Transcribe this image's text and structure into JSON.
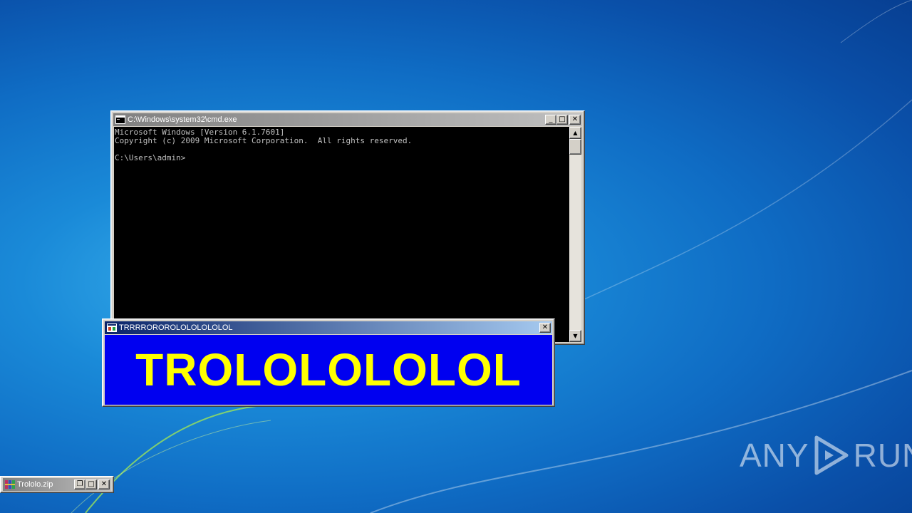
{
  "desktop": {
    "watermark_left": "ANY",
    "watermark_right": "RUN"
  },
  "cmd_window": {
    "title": "C:\\Windows\\system32\\cmd.exe",
    "console_lines": [
      "Microsoft Windows [Version 6.1.7601]",
      "Copyright (c) 2009 Microsoft Corporation.  All rights reserved.",
      "",
      "C:\\Users\\admin>"
    ],
    "minimize_glyph": "_",
    "maximize_glyph": "□",
    "close_glyph": "✕",
    "scroll_up_glyph": "▲",
    "scroll_down_glyph": "▼"
  },
  "troll_window": {
    "title": "TRRRROROROLOLOLOLOLOL",
    "message": "TROLOLOLOLOL",
    "message_color": "#ffff00",
    "background_color": "#0000f0",
    "close_glyph": "✕"
  },
  "zip_window": {
    "title": "Trololo.zip",
    "restore_glyph": "❐",
    "maximize_glyph": "□",
    "close_glyph": "✕"
  },
  "colors": {
    "active_title": "#0a246a",
    "inactive_title": "#808080",
    "console_bg": "#000000",
    "console_fg": "#c0c0c0"
  }
}
